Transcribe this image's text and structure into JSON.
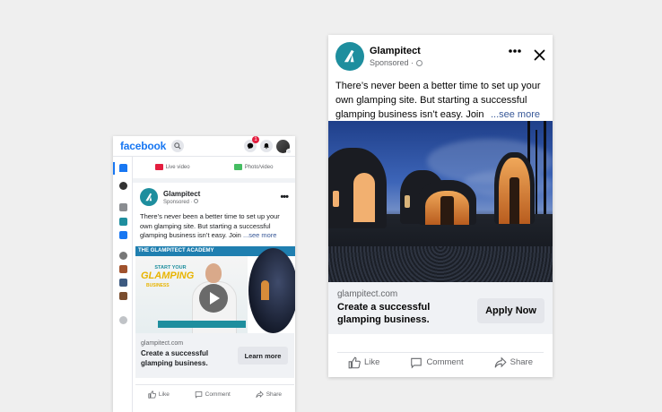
{
  "phone": {
    "logo": "facebook",
    "notification_count": "1",
    "compose": {
      "live_video": "Live video",
      "photo_video": "Photo/video"
    },
    "post": {
      "page_name": "Glampitect",
      "sponsored": "Sponsored · ",
      "text": "There’s never been a better time to set up your own glamping site. But starting a successful glamping business isn’t easy. Join",
      "see_more": "...see more",
      "banner": "THE GLAMPITECT ACADEMY",
      "video_kicker": "START YOUR",
      "video_headline": "GLAMPING",
      "video_tag": "BUSINESS"
    },
    "cta": {
      "domain": "glampitect.com",
      "title": "Create a successful glamping business.",
      "button": "Learn more"
    },
    "actions": {
      "like": "Like",
      "comment": "Comment",
      "share": "Share"
    }
  },
  "card": {
    "page_name": "Glampitect",
    "sponsored": "Sponsored ·",
    "text": "There’s never been a better time to set up your own glamping site. But starting a successful glamping business isn’t easy. Join",
    "see_more": "...see more",
    "cta": {
      "domain": "glampitect.com",
      "title": "Create a successful glamping business.",
      "button": "Apply Now"
    },
    "actions": {
      "like": "Like",
      "comment": "Comment",
      "share": "Share"
    }
  },
  "colors": {
    "brand_teal": "#1e8e9e",
    "facebook_blue": "#1877f2",
    "link_blue": "#385898"
  },
  "icons": [
    "search-icon",
    "messenger-icon",
    "bell-icon",
    "more-icon",
    "close-icon",
    "like-icon",
    "comment-icon",
    "share-icon",
    "play-icon",
    "globe-icon",
    "glampitect-logo-icon"
  ]
}
